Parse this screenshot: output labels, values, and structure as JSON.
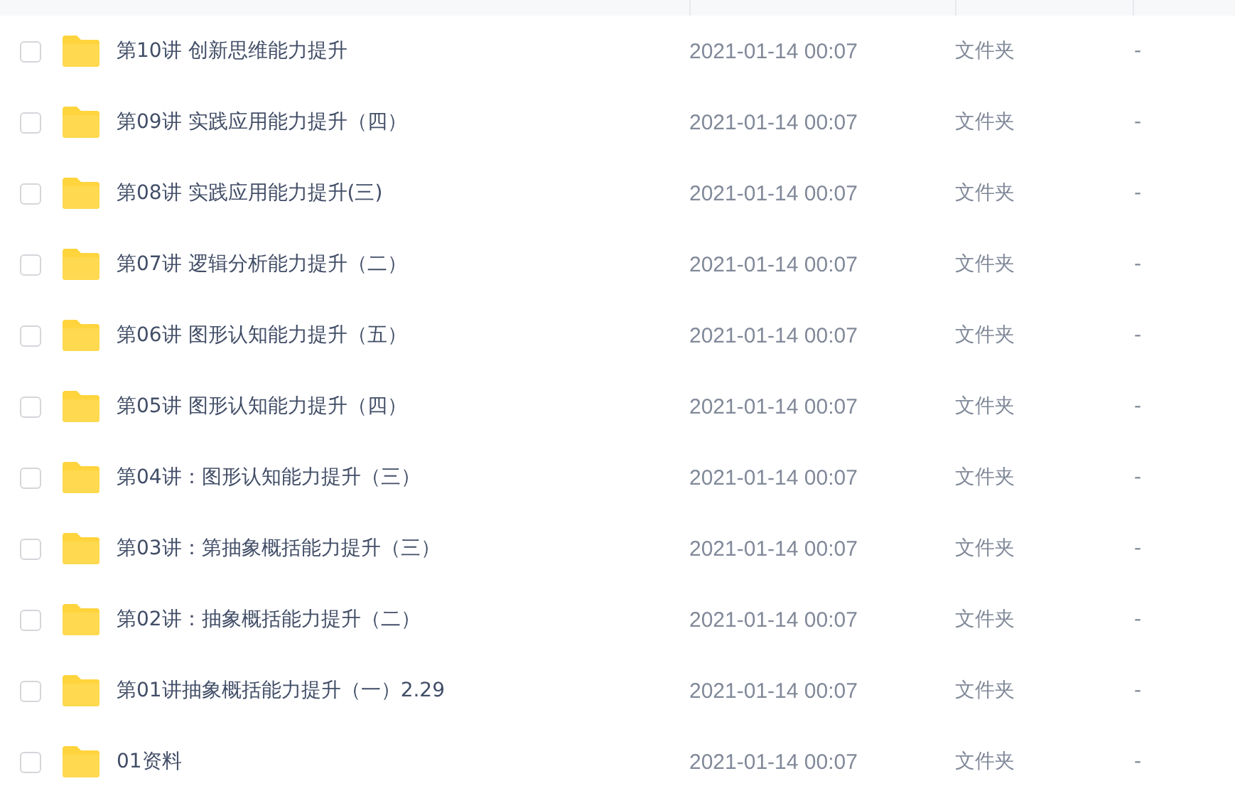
{
  "files": [
    {
      "name": "第10讲 创新思维能力提升",
      "modified": "2021-01-14 00:07",
      "type": "文件夹",
      "size": "-",
      "checked": false
    },
    {
      "name": "第09讲 实践应用能力提升（四）",
      "modified": "2021-01-14 00:07",
      "type": "文件夹",
      "size": "-",
      "checked": false
    },
    {
      "name": "第08讲 实践应用能力提升(三)",
      "modified": "2021-01-14 00:07",
      "type": "文件夹",
      "size": "-",
      "checked": false
    },
    {
      "name": "第07讲 逻辑分析能力提升（二）",
      "modified": "2021-01-14 00:07",
      "type": "文件夹",
      "size": "-",
      "checked": false
    },
    {
      "name": "第06讲 图形认知能力提升（五）",
      "modified": "2021-01-14 00:07",
      "type": "文件夹",
      "size": "-",
      "checked": false
    },
    {
      "name": "第05讲 图形认知能力提升（四）",
      "modified": "2021-01-14 00:07",
      "type": "文件夹",
      "size": "-",
      "checked": false
    },
    {
      "name": "第04讲：图形认知能力提升（三）",
      "modified": "2021-01-14 00:07",
      "type": "文件夹",
      "size": "-",
      "checked": false
    },
    {
      "name": "第03讲：第抽象概括能力提升（三）",
      "modified": "2021-01-14 00:07",
      "type": "文件夹",
      "size": "-",
      "checked": false
    },
    {
      "name": "第02讲：抽象概括能力提升（二）",
      "modified": "2021-01-14 00:07",
      "type": "文件夹",
      "size": "-",
      "checked": false
    },
    {
      "name": "第01讲抽象概括能力提升（一）2.29",
      "modified": "2021-01-14 00:07",
      "type": "文件夹",
      "size": "-",
      "checked": false
    },
    {
      "name": "01资料",
      "modified": "2021-01-14 00:07",
      "type": "文件夹",
      "size": "-",
      "checked": false
    }
  ]
}
